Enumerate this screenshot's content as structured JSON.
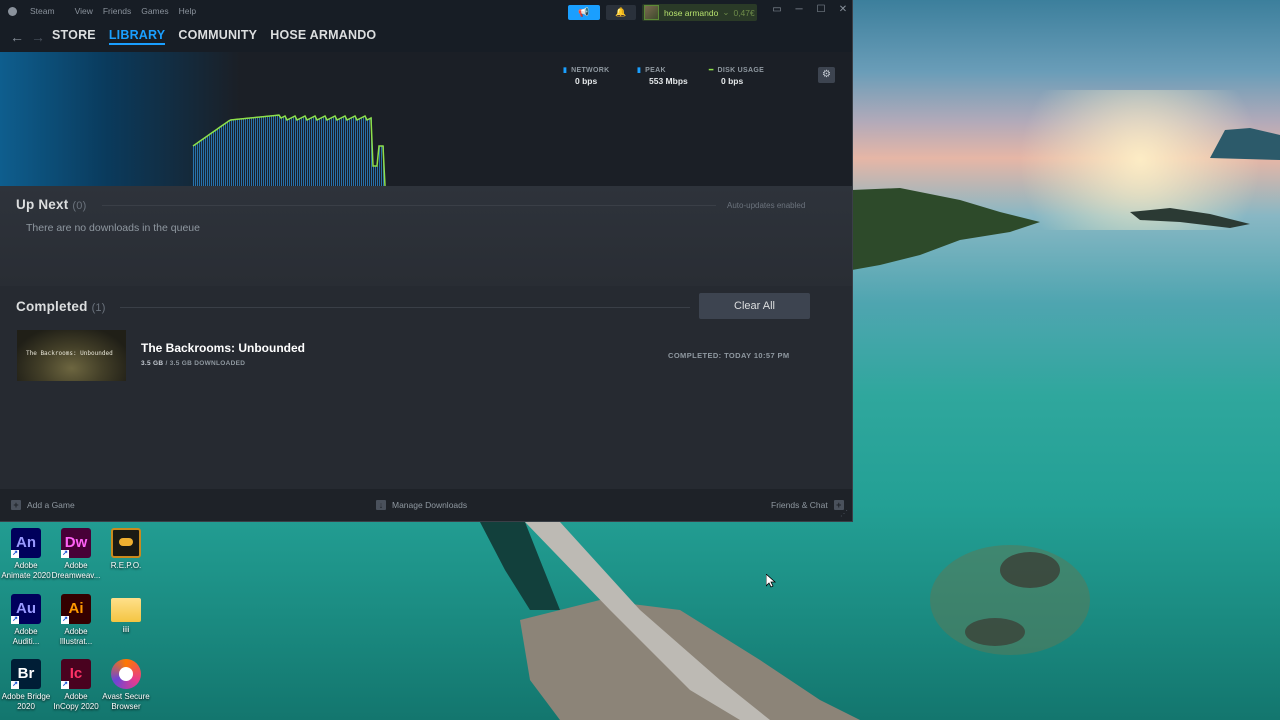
{
  "window": {
    "menu": [
      "Steam",
      "View",
      "Friends",
      "Games",
      "Help"
    ],
    "user": {
      "name": "hose armando",
      "balance": "0,47€"
    },
    "nav": [
      "STORE",
      "LIBRARY",
      "COMMUNITY",
      "HOSE ARMANDO"
    ]
  },
  "stats": {
    "network_label": "NETWORK",
    "network_value": "0 bps",
    "peak_label": "PEAK",
    "peak_value": "553 Mbps",
    "disk_label": "DISK USAGE",
    "disk_value": "0 bps"
  },
  "up_next": {
    "title": "Up Next",
    "count": "(0)",
    "auto_updates": "Auto-updates enabled",
    "empty": "There are no downloads in the queue"
  },
  "completed": {
    "title": "Completed",
    "count": "(1)",
    "clear_all": "Clear All",
    "items": [
      {
        "thumb_text": "The Backrooms: Unbounded",
        "name": "The Backrooms: Unbounded",
        "size_done": "3.5 GB",
        "size_total": "/ 3.5 GB DOWNLOADED",
        "completed_at": "COMPLETED: TODAY 10:57 PM"
      }
    ]
  },
  "footer": {
    "add_game": "Add a Game",
    "manage": "Manage Downloads",
    "friends": "Friends & Chat"
  },
  "desktop": {
    "icons": [
      {
        "glyph": "An",
        "label": "Adobe Animate 2020"
      },
      {
        "glyph": "Dw",
        "label": "Adobe Dreamweav..."
      },
      {
        "glyph": "",
        "label": "R.E.P.O."
      },
      {
        "glyph": "Au",
        "label": "Adobe Auditi..."
      },
      {
        "glyph": "Ai",
        "label": "Adobe Illustrat..."
      },
      {
        "glyph": "",
        "label": "iiii"
      },
      {
        "glyph": "Br",
        "label": "Adobe Bridge 2020"
      },
      {
        "glyph": "Ic",
        "label": "Adobe InCopy 2020"
      },
      {
        "glyph": "",
        "label": "Avast Secure Browser"
      }
    ]
  },
  "colors": {
    "accent": "#1a9fff",
    "graph_line": "#8ee04a",
    "window_bg": "#24282f"
  }
}
